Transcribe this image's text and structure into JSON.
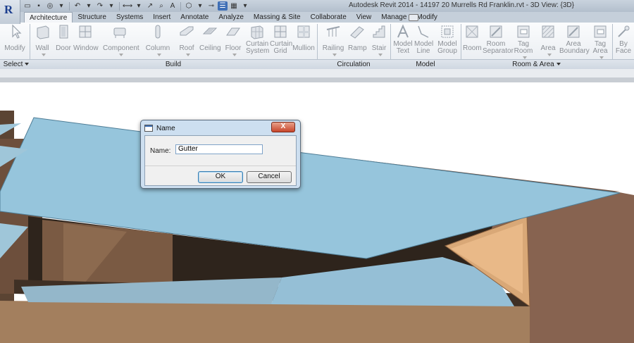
{
  "window": {
    "title": "Autodesk Revit 2014 -   14197 20 Murrells Rd Franklin.rvt - 3D View: {3D}"
  },
  "tabs": [
    "Architecture",
    "Structure",
    "Systems",
    "Insert",
    "Annotate",
    "Analyze",
    "Massing & Site",
    "Collaborate",
    "View",
    "Manage",
    "Modify"
  ],
  "ribbon": {
    "modify": "Modify",
    "wall": "Wall",
    "door": "Door",
    "window": "Window",
    "component": "Component",
    "column": "Column",
    "roof": "Roof",
    "ceiling": "Ceiling",
    "floor": "Floor",
    "curtain_system_1": "Curtain",
    "curtain_system_2": "System",
    "curtain_grid_1": "Curtain",
    "curtain_grid_2": "Grid",
    "mullion": "Mullion",
    "railing": "Railing",
    "ramp": "Ramp",
    "stair": "Stair",
    "model_text_1": "Model",
    "model_text_2": "Text",
    "model_line_1": "Model",
    "model_line_2": "Line",
    "model_group_1": "Model",
    "model_group_2": "Group",
    "room": "Room",
    "room_separator_1": "Room",
    "room_separator_2": "Separator",
    "tag_room_1": "Tag",
    "tag_room_2": "Room",
    "area": "Area",
    "area_boundary_1": "Area",
    "area_boundary_2": "Boundary",
    "tag_area_1": "Tag",
    "tag_area_2": "Area",
    "by_face_1": "By",
    "by_face_2": "Face"
  },
  "panels": {
    "select": "Select",
    "build": "Build",
    "circulation": "Circulation",
    "model": "Model",
    "room_area": "Room & Area"
  },
  "dialog": {
    "title": "Name",
    "close": "X",
    "name_label": "Name:",
    "name_value": "Gutter",
    "ok": "OK",
    "cancel": "Cancel"
  }
}
